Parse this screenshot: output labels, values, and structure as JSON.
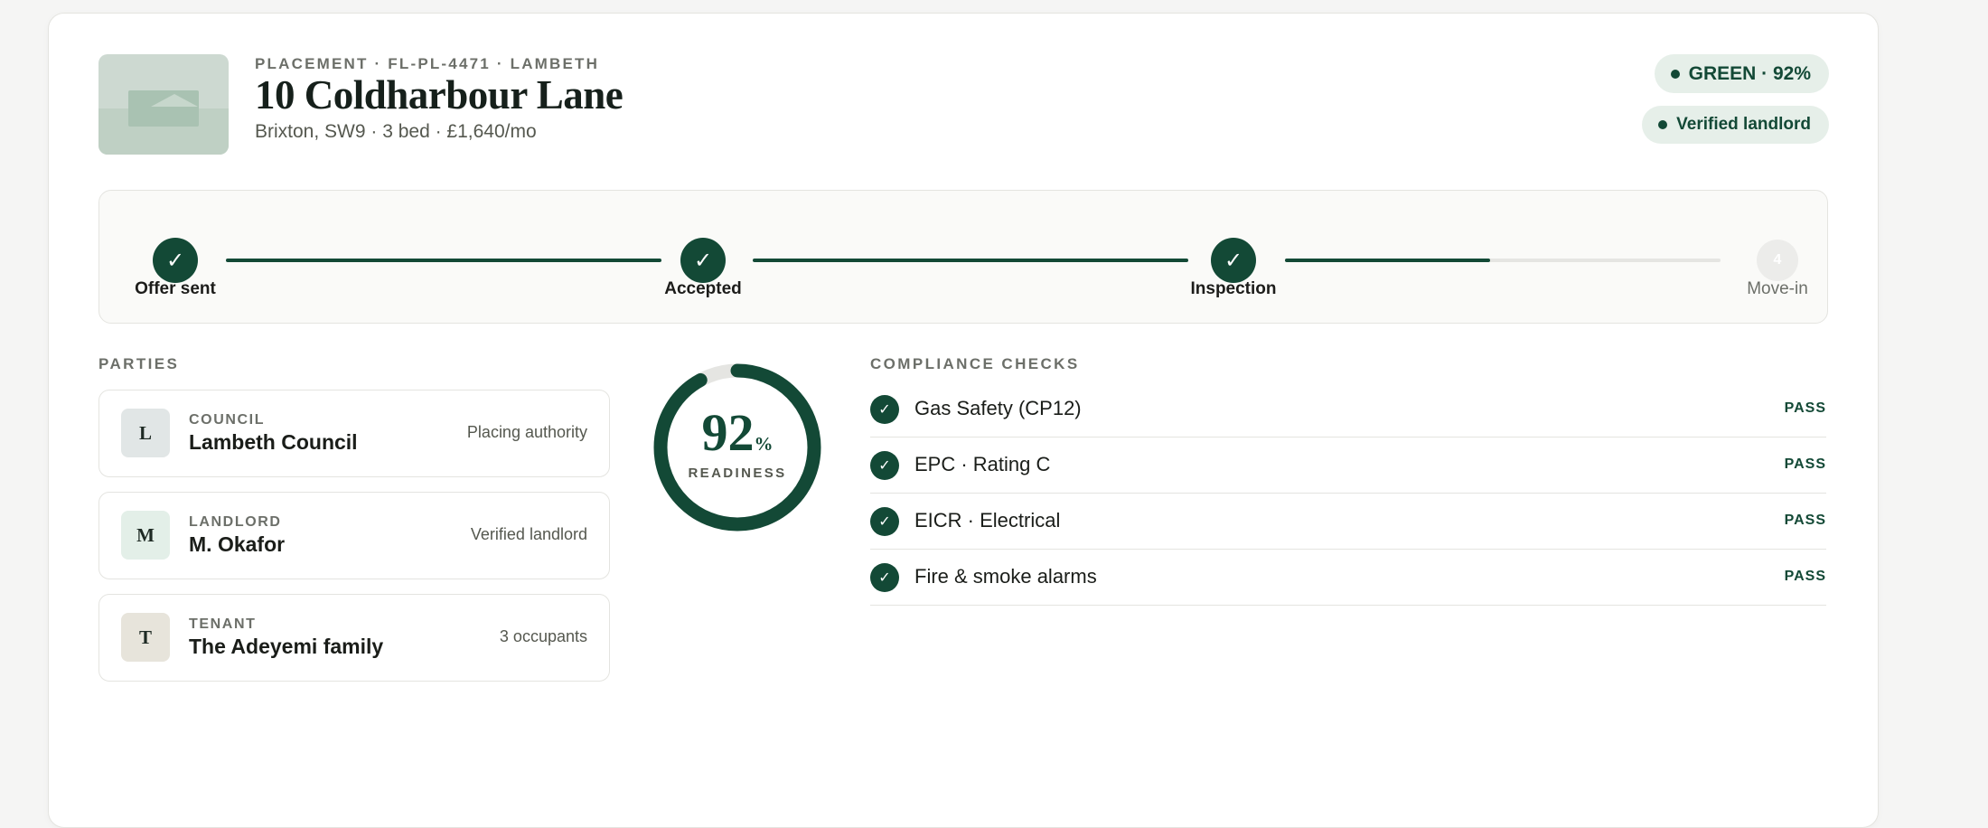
{
  "colors": {
    "accent": "#134936",
    "track_pending": "#e5e5e2",
    "page_bg": "#f5f5f4"
  },
  "placement": {
    "eyebrow": "PLACEMENT · FL-PL-4471 · LAMBETH",
    "title": "10 Coldharbour Lane",
    "subtitle": "Brixton, SW9 · 3 bed · £1,640/mo",
    "thumbnail_icon": "house-image-icon"
  },
  "badges": {
    "status": "GREEN · 92%",
    "verified": "Verified landlord"
  },
  "stepper": {
    "steps": [
      {
        "label": "Offer sent",
        "mark": "✓",
        "state": "done"
      },
      {
        "label": "Accepted",
        "mark": "✓",
        "state": "done"
      },
      {
        "label": "Inspection",
        "mark": "✓",
        "state": "done"
      },
      {
        "label": "Move-in",
        "mark": "4",
        "state": "pending"
      }
    ],
    "last_segment_progress": 0.47
  },
  "parties": {
    "title": "PARTIES",
    "items": [
      {
        "initial": "L",
        "role": "COUNCIL",
        "name": "Lambeth Council",
        "note": "Placing authority",
        "avatar_color": "#e1e6e6"
      },
      {
        "initial": "M",
        "role": "LANDLORD",
        "name": "M. Okafor",
        "note": "Verified landlord",
        "avatar_color": "#e3efe8"
      },
      {
        "initial": "T",
        "role": "TENANT",
        "name": "The Adeyemi family",
        "note": "3 occupants",
        "avatar_color": "#e7e4db"
      }
    ]
  },
  "readiness": {
    "value": 92,
    "unit": "%",
    "label": "READINESS"
  },
  "compliance": {
    "title": "COMPLIANCE CHECKS",
    "items": [
      {
        "label": "Gas Safety (CP12)",
        "status": "PASS"
      },
      {
        "label": "EPC · Rating C",
        "status": "PASS"
      },
      {
        "label": "EICR · Electrical",
        "status": "PASS"
      },
      {
        "label": "Fire & smoke alarms",
        "status": "PASS"
      }
    ]
  }
}
